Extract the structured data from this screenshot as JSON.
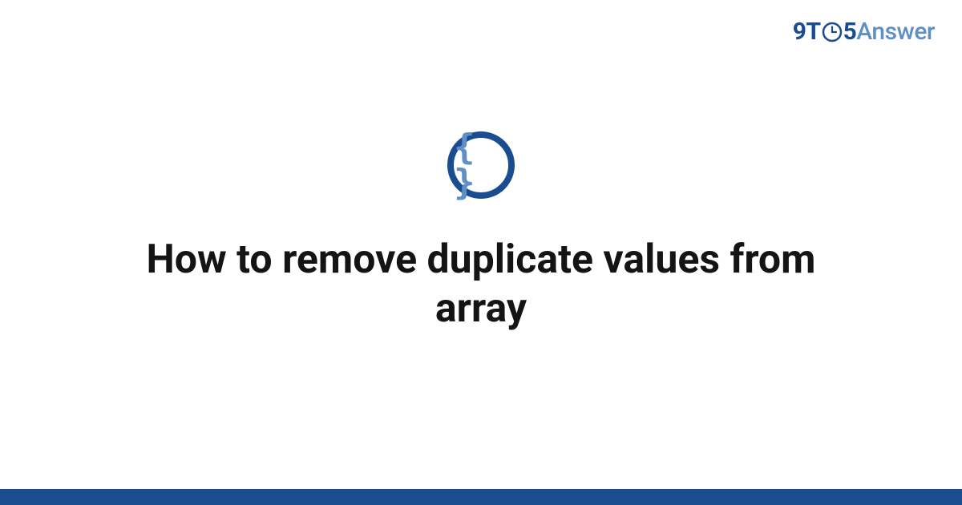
{
  "logo": {
    "prefix": "9T",
    "middle_digit": "5",
    "suffix": "Answer"
  },
  "category": {
    "icon_glyph": "{ }",
    "icon_name": "code-braces"
  },
  "title": "How to remove duplicate values from array",
  "colors": {
    "brand_dark": "#1a4d8f",
    "brand_light": "#5f8fc7",
    "text": "#141414",
    "bg": "#ffffff"
  }
}
